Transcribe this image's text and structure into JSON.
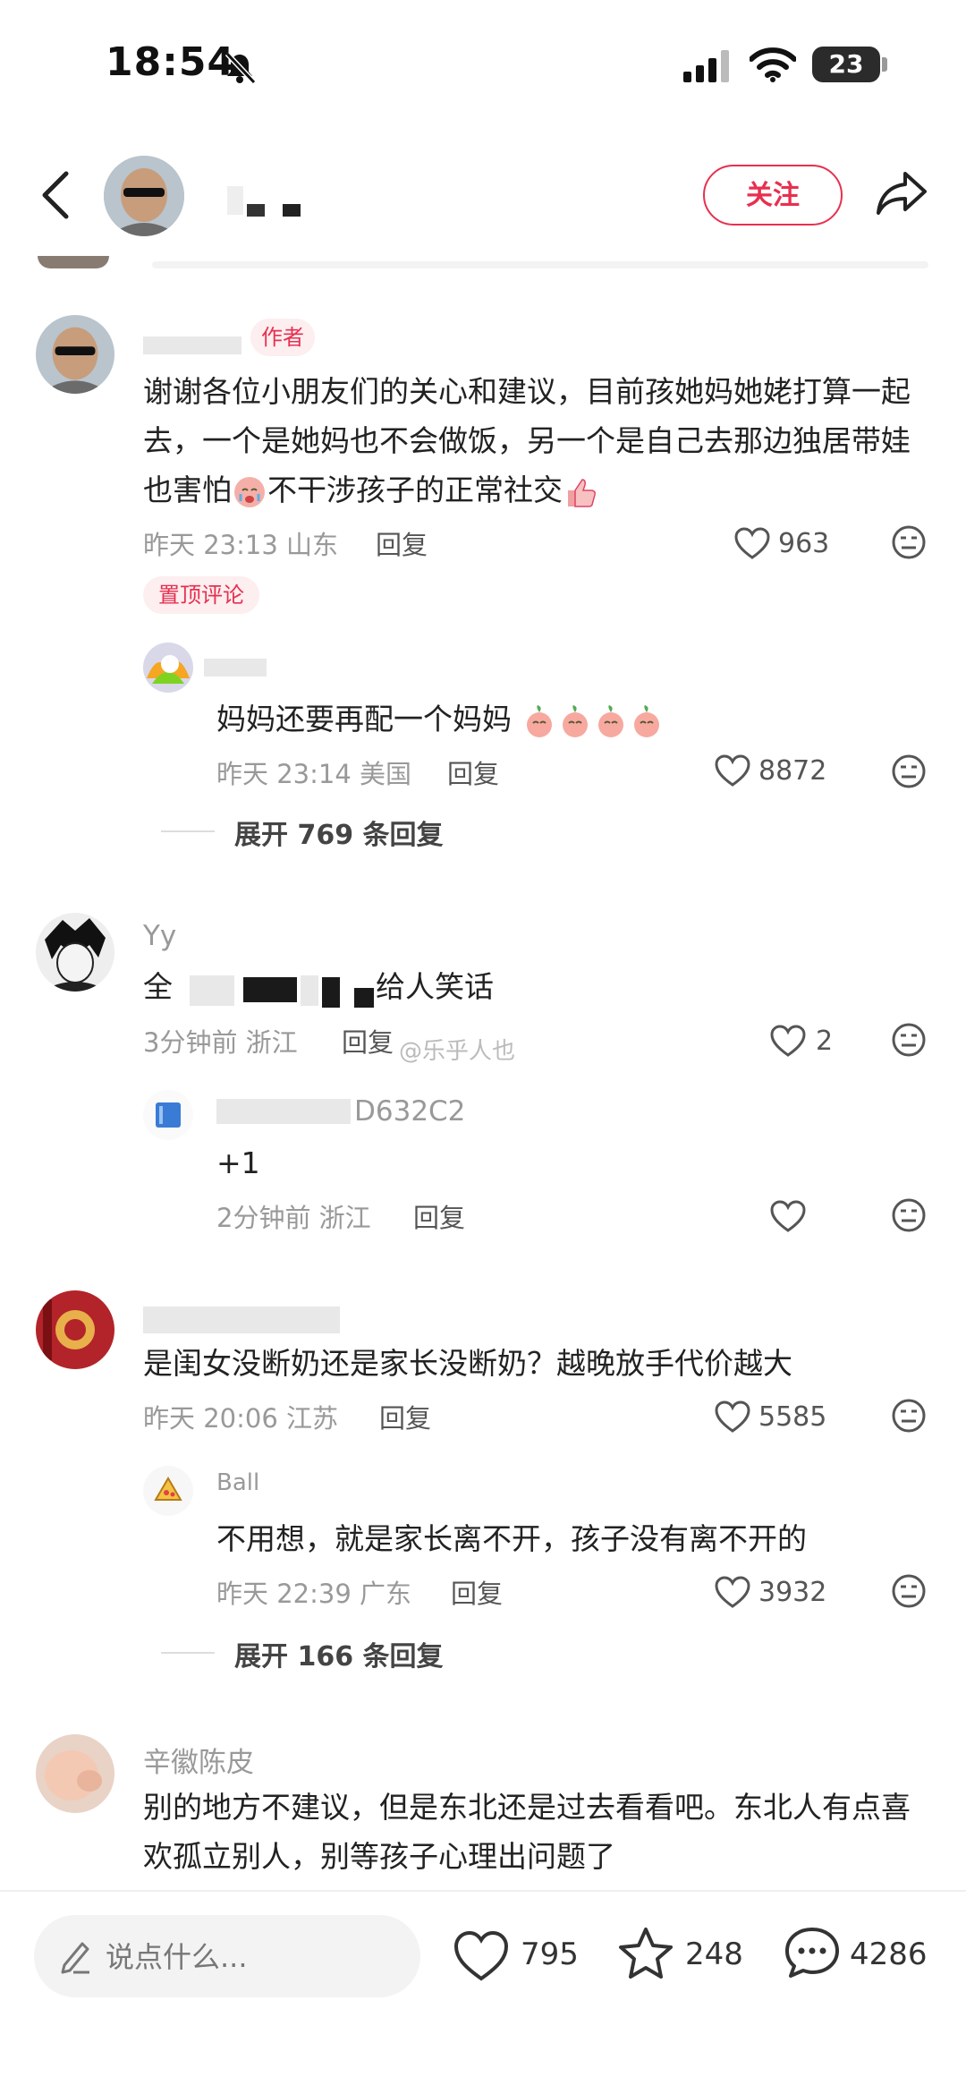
{
  "status_bar": {
    "time": "18:54",
    "battery": "23"
  },
  "header": {
    "follow_label": "关注"
  },
  "comments": [
    {
      "author_tag": "作者",
      "text": "谢谢各位小朋友们的关心和建议，目前孩她妈她姥打算一起去，一个是她妈也不会做饭，另一个是自己去那边独居带娃也害怕",
      "text_after_emoji": "不干涉孩子的正常社交",
      "time": "昨天 23:13",
      "location": "山东",
      "reply_label": "回复",
      "likes": "963",
      "pinned_tag": "置顶评论",
      "sub_reply": {
        "text": "妈妈还要再配一个妈妈",
        "time": "昨天 23:14",
        "location": "美国",
        "reply_label": "回复",
        "likes": "8872"
      },
      "expand_label": "展开 769 条回复"
    },
    {
      "name": "Yy",
      "text_start": "全",
      "text_end": "给人笑话",
      "time": "3分钟前",
      "location": "浙江",
      "reply_label": "回复",
      "likes": "2",
      "watermark": "@乐乎人也",
      "sub_reply": {
        "name": "D632C2",
        "text": "+1",
        "time": "2分钟前",
        "location": "浙江",
        "reply_label": "回复"
      }
    },
    {
      "text": "是闺女没断奶还是家长没断奶？越晚放手代价越大",
      "time": "昨天 20:06",
      "location": "江苏",
      "reply_label": "回复",
      "likes": "5585",
      "sub_reply": {
        "name": "Ball",
        "text": "不用想，就是家长离不开，孩子没有离不开的",
        "time": "昨天 22:39",
        "location": "广东",
        "reply_label": "回复",
        "likes": "3932"
      },
      "expand_label": "展开 166 条回复"
    },
    {
      "name": "辛徽陈皮",
      "text": "别的地方不建议，但是东北还是过去看看吧。东北人有点喜欢孤立别人，别等孩子心理出问题了"
    }
  ],
  "bottom_bar": {
    "input_placeholder": "说点什么...",
    "likes": "795",
    "stars": "248",
    "comments": "4286"
  },
  "colors": {
    "accent": "#e7304f",
    "muted": "#999999"
  }
}
